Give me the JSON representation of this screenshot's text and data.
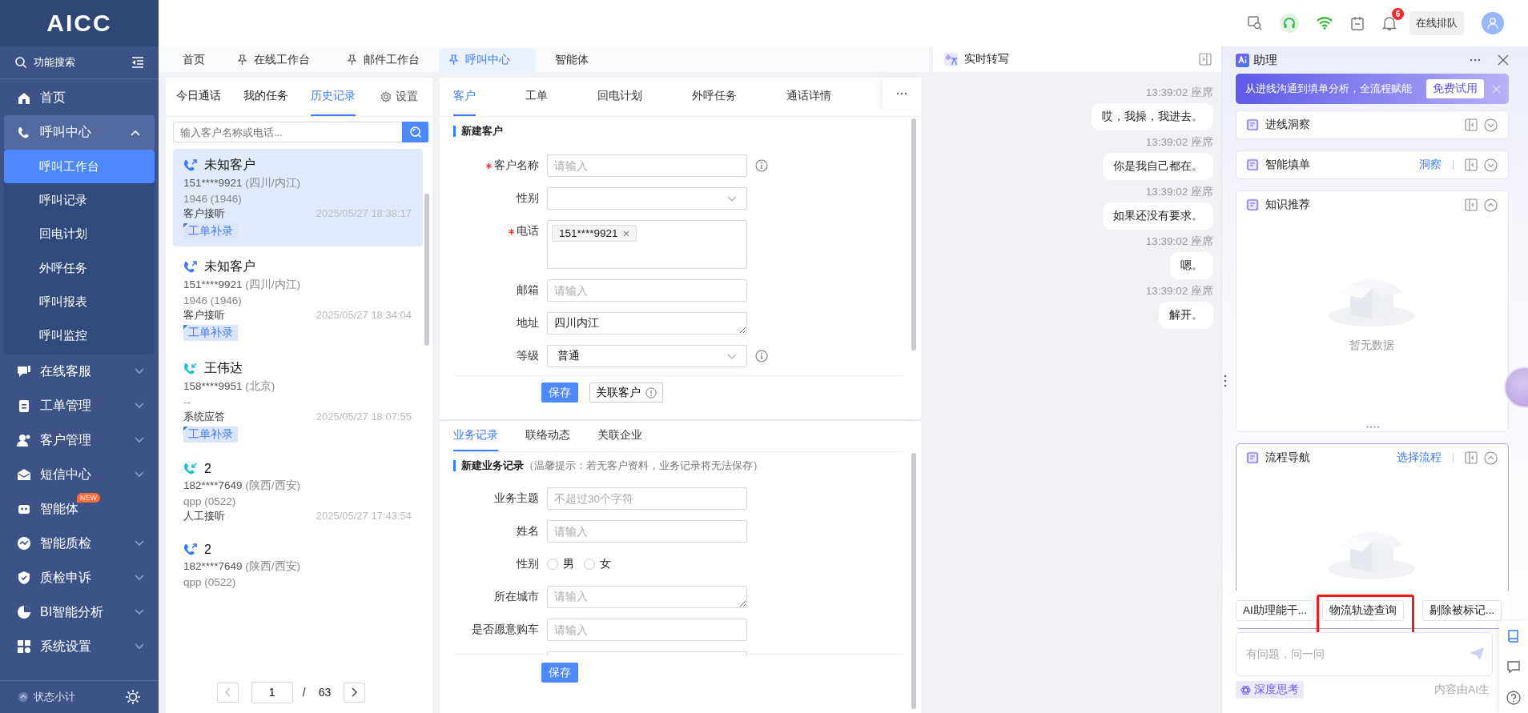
{
  "app": {
    "logo": "AICC"
  },
  "sidebar": {
    "search": "功能搜索",
    "items": [
      {
        "kind": "link",
        "label": "首页",
        "selected": false
      },
      {
        "kind": "group",
        "label": "呼叫中心",
        "expanded": true,
        "children": [
          {
            "label": "呼叫工作台",
            "selected": true
          },
          {
            "label": "呼叫记录",
            "selected": false
          },
          {
            "label": "回电计划",
            "selected": false
          },
          {
            "label": "外呼任务",
            "selected": false
          },
          {
            "label": "呼叫报表",
            "selected": false
          },
          {
            "label": "呼叫监控",
            "selected": false
          }
        ]
      },
      {
        "kind": "group",
        "label": "在线客服",
        "expanded": false
      },
      {
        "kind": "group",
        "label": "工单管理",
        "expanded": false
      },
      {
        "kind": "group",
        "label": "客户管理",
        "expanded": false
      },
      {
        "kind": "group",
        "label": "短信中心",
        "expanded": false
      },
      {
        "kind": "link",
        "label": "智能体",
        "badge": "NEW",
        "selected": false
      },
      {
        "kind": "group",
        "label": "智能质检",
        "expanded": false
      },
      {
        "kind": "group",
        "label": "质检申诉",
        "expanded": false
      },
      {
        "kind": "group",
        "label": "BI智能分析",
        "expanded": false
      },
      {
        "kind": "group",
        "label": "系统设置",
        "expanded": false
      }
    ],
    "footer": "状态小计"
  },
  "topbar": {
    "notifications": "6",
    "queue_button": "在线排队"
  },
  "tabs": [
    {
      "label": "首页",
      "pinned": false,
      "selected": false
    },
    {
      "label": "在线工作台",
      "pinned": true,
      "selected": false
    },
    {
      "label": "邮件工作台",
      "pinned": true,
      "selected": false
    },
    {
      "label": "呼叫中心",
      "pinned": true,
      "selected": true
    },
    {
      "label": "智能体",
      "pinned": false,
      "selected": false
    }
  ],
  "call_panel": {
    "tabs": [
      {
        "label": "今日通话",
        "selected": false
      },
      {
        "label": "我的任务",
        "selected": false
      },
      {
        "label": "历史记录",
        "selected": true
      }
    ],
    "settings": "设置",
    "search": {
      "placeholder": "输入客户名称或电话..."
    },
    "records": [
      {
        "kind": "outgoing",
        "name": "未知客户",
        "phone": "151****9921",
        "region": "(四川/内江)",
        "detail": "1946 (1946)",
        "status": "客户接听",
        "time": "2025/05/27 18:38:17",
        "tag": "工单补录",
        "selected": true
      },
      {
        "kind": "outgoing",
        "name": "未知客户",
        "phone": "151****9921",
        "region": "(四川/内江)",
        "detail": "1946 (1946)",
        "status": "客户接听",
        "time": "2025/05/27 18:34:04",
        "tag": "工单补录",
        "selected": false
      },
      {
        "kind": "incoming",
        "name": "王伟达",
        "phone": "158****9951",
        "region": "(北京)",
        "detail": "--",
        "status": "系统应答",
        "time": "2025/05/27 18:07:55",
        "tag": "工单补录",
        "selected": false
      },
      {
        "kind": "incoming",
        "name": "2",
        "phone": "182****7649",
        "region": "(陕西/西安)",
        "detail": "qpp (0522)",
        "status": "人工接听",
        "time": "2025/05/27 17:43:54",
        "selected": false
      },
      {
        "kind": "outgoing",
        "name": "2",
        "phone": "182****7649",
        "region": "(陕西/西安)",
        "detail": "qpp (0522)",
        "selected": false
      }
    ],
    "pagination": {
      "page": "1",
      "separator": "/",
      "total": "63"
    }
  },
  "customer_panel": {
    "tabs": [
      {
        "label": "客户",
        "selected": true
      },
      {
        "label": "工单",
        "selected": false
      },
      {
        "label": "回电计划",
        "selected": false
      },
      {
        "label": "外呼任务",
        "selected": false
      },
      {
        "label": "通话详情",
        "selected": false
      }
    ],
    "title": "新建客户",
    "fields": [
      {
        "kind": "input",
        "label": "客户名称",
        "required": true,
        "info": true,
        "placeholder": "请输入"
      },
      {
        "kind": "select",
        "label": "性别",
        "required": false,
        "info": false
      },
      {
        "kind": "tags",
        "label": "电话",
        "required": true,
        "info": false,
        "tags": [
          "151****9921"
        ]
      },
      {
        "kind": "input",
        "label": "邮箱",
        "required": false,
        "info": false,
        "placeholder": "请输入"
      },
      {
        "kind": "textarea",
        "label": "地址",
        "required": false,
        "info": false,
        "value": "四川内江"
      },
      {
        "kind": "select",
        "label": "等级",
        "required": false,
        "info": true,
        "value": "普通"
      }
    ],
    "save": "保存",
    "link_button": "关联客户"
  },
  "record_panel": {
    "tabs": [
      {
        "label": "业务记录",
        "selected": true
      },
      {
        "label": "联络动态",
        "selected": false
      },
      {
        "label": "关联企业",
        "selected": false
      }
    ],
    "title": "新建业务记录",
    "hint": "（温馨提示：若无客户资料，业务记录将无法保存）",
    "fields": [
      {
        "kind": "input",
        "label": "业务主题",
        "placeholder": "不超过30个字符"
      },
      {
        "kind": "input",
        "label": "姓名",
        "placeholder": "请输入"
      },
      {
        "kind": "radio",
        "label": "性别",
        "options": [
          {
            "label": "男",
            "selected": false
          },
          {
            "label": "女",
            "selected": false
          }
        ]
      },
      {
        "kind": "textarea",
        "label": "所在城市",
        "placeholder": "请输入"
      },
      {
        "kind": "input",
        "label": "是否愿意购车",
        "placeholder": "请输入"
      }
    ],
    "save": "保存"
  },
  "transcript": {
    "title": "实时转写",
    "messages": [
      {
        "time": "13:39:02",
        "speaker": "座席",
        "text": "哎，我操，我进去。"
      },
      {
        "time": "13:39:02",
        "speaker": "座席",
        "text": "你是我自己都在。"
      },
      {
        "time": "13:39:02",
        "speaker": "座席",
        "text": "如果还没有要求。"
      },
      {
        "time": "13:39:02",
        "speaker": "座席",
        "text": "嗯。"
      },
      {
        "time": "13:39:02",
        "speaker": "座席",
        "text": "解开。"
      }
    ]
  },
  "assistant": {
    "title": "助理",
    "banner": {
      "text": "从进线沟通到填单分析，全流程赋能",
      "button": "免费试用"
    },
    "cards": [
      {
        "title": "进线洞察",
        "expanded": false,
        "focused": false
      },
      {
        "title": "智能填单",
        "link": "洞察",
        "expanded": false,
        "focused": false
      },
      {
        "title": "知识推荐",
        "expanded": true,
        "focused": false,
        "empty_text": "暂无数据"
      },
      {
        "title": "流程导航",
        "link": "选择流程",
        "expanded": true,
        "focused": true
      }
    ],
    "chips": [
      {
        "label": "AI助理能干...",
        "highlighted": false
      },
      {
        "label": "物流轨迹查询",
        "highlighted": true
      },
      {
        "label": "剔除被标记...",
        "highlighted": false
      }
    ],
    "input": {
      "placeholder": "有问题，问一问"
    },
    "deep_think": "深度思考",
    "disclaimer": "内容由AI生"
  }
}
